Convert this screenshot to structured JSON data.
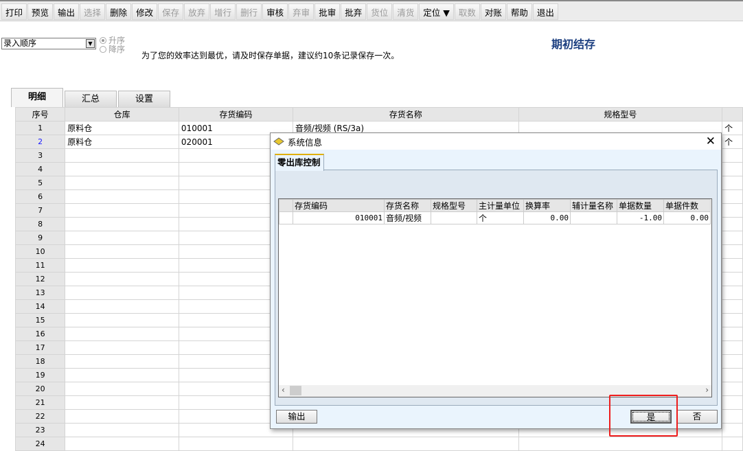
{
  "toolbar": [
    {
      "label": "打印",
      "enabled": true
    },
    {
      "label": "预览",
      "enabled": true
    },
    {
      "label": "输出",
      "enabled": true
    },
    {
      "label": "选择",
      "enabled": false
    },
    {
      "label": "删除",
      "enabled": true
    },
    {
      "label": "修改",
      "enabled": true
    },
    {
      "label": "保存",
      "enabled": false
    },
    {
      "label": "放弃",
      "enabled": false
    },
    {
      "label": "增行",
      "enabled": false
    },
    {
      "label": "删行",
      "enabled": false
    },
    {
      "label": "审核",
      "enabled": true
    },
    {
      "label": "弃审",
      "enabled": false
    },
    {
      "label": "批审",
      "enabled": true
    },
    {
      "label": "批弃",
      "enabled": true
    },
    {
      "label": "货位",
      "enabled": false
    },
    {
      "label": "清货",
      "enabled": false
    },
    {
      "label": "定位 ▼",
      "enabled": true
    },
    {
      "label": "取数",
      "enabled": false
    },
    {
      "label": "对账",
      "enabled": true
    },
    {
      "label": "帮助",
      "enabled": true
    },
    {
      "label": "退出",
      "enabled": true
    }
  ],
  "sort": {
    "selected": "录入顺序",
    "asc": "升序",
    "desc": "降序"
  },
  "hint": "为了您的效率达到最优，请及时保存单据，建议约10条记录保存一次。",
  "page_title": "期初结存",
  "tabs": [
    "明细",
    "汇总",
    "设置"
  ],
  "grid": {
    "headers": [
      "序号",
      "仓库",
      "存货编码",
      "存货名称",
      "规格型号",
      ""
    ],
    "rows": [
      [
        "1",
        "原料仓",
        "010001",
        "音频/视频 (RS/3a)",
        "",
        "个"
      ],
      [
        "2",
        "原料仓",
        "020001",
        "",
        "",
        "个"
      ]
    ],
    "row_count": 24
  },
  "dialog": {
    "title": "系统信息",
    "tab": "零出库控制",
    "headers": [
      "",
      "存货编码",
      "存货名称",
      "规格型号",
      "主计量单位",
      "换算率",
      "辅计量名称",
      "单据数量",
      "单据件数"
    ],
    "rows": [
      [
        "",
        "010001",
        "音频/视频",
        "",
        "个",
        "0.00",
        "",
        "-1.00",
        "0.00"
      ]
    ],
    "export": "输出",
    "yes": "是",
    "no": "否"
  }
}
